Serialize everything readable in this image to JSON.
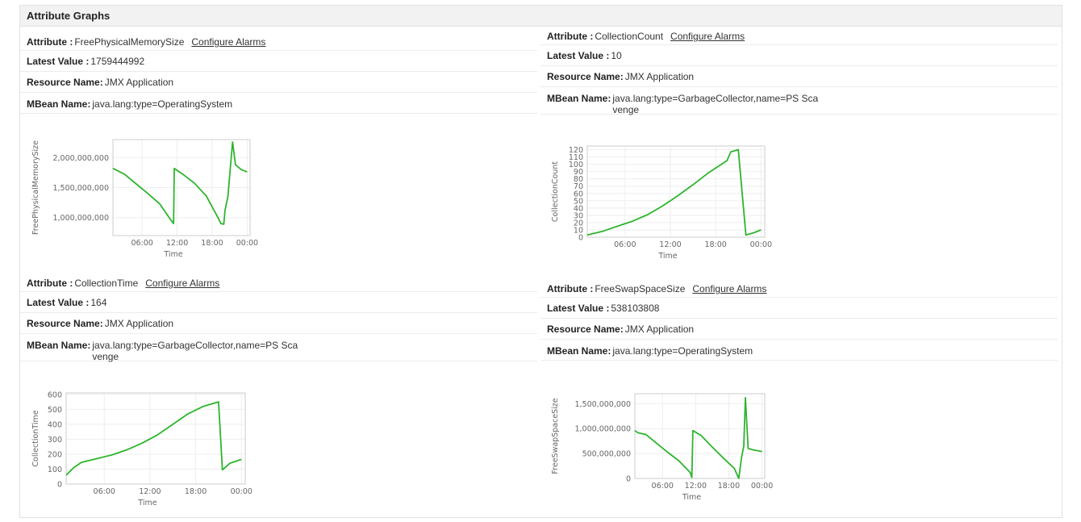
{
  "panel": {
    "title": "Attribute Graphs"
  },
  "labels": {
    "attribute": "Attribute :",
    "latest_value": "Latest Value :",
    "resource_name": "Resource Name:",
    "mbean_name": "MBean Name:",
    "configure_alarms": "Configure Alarms"
  },
  "cards": [
    {
      "attribute": "FreePhysicalMemorySize",
      "latest_value": "1759444992",
      "resource_name": "JMX Application",
      "mbean_name": "java.lang:type=OperatingSystem"
    },
    {
      "attribute": "CollectionCount",
      "latest_value": "10",
      "resource_name": "JMX Application",
      "mbean_name": "java.lang:type=GarbageCollector,name=PS Scavenge"
    },
    {
      "attribute": "CollectionTime",
      "latest_value": "164",
      "resource_name": "JMX Application",
      "mbean_name": "java.lang:type=GarbageCollector,name=PS Scavenge"
    },
    {
      "attribute": "FreeSwapSpaceSize",
      "latest_value": "538103808",
      "resource_name": "JMX Application",
      "mbean_name": "java.lang:type=OperatingSystem"
    }
  ],
  "line_color": "#2db52d",
  "chart_data": [
    {
      "type": "line",
      "ylabel": "FreePhysicalMemorySize",
      "xlabel": "Time",
      "x_ticks": [
        "06:00",
        "12:00",
        "18:00",
        "00:00"
      ],
      "x_tick_hours": [
        6,
        12,
        18,
        24
      ],
      "xlim": [
        1,
        24.5
      ],
      "y_ticks": [
        "1,000,000,000",
        "1,500,000,000",
        "2,000,000,000"
      ],
      "y_tick_values": [
        1000000000,
        1500000000,
        2000000000
      ],
      "ylim": [
        700000000,
        2300000000
      ],
      "x": [
        1.0,
        3.0,
        5.0,
        7.0,
        9.0,
        11.0,
        11.4,
        11.5,
        13.0,
        15.0,
        17.0,
        19.0,
        19.5,
        20.0,
        20.2,
        20.7,
        21.0,
        21.5,
        22.0,
        23.0,
        24.0
      ],
      "y": [
        1820000000,
        1720000000,
        1560000000,
        1400000000,
        1230000000,
        950000000,
        900000000,
        1820000000,
        1720000000,
        1570000000,
        1360000000,
        1000000000,
        900000000,
        890000000,
        1120000000,
        1350000000,
        1700000000,
        2260000000,
        1880000000,
        1800000000,
        1760000000
      ]
    },
    {
      "type": "line",
      "ylabel": "CollectionCount",
      "xlabel": "Time",
      "x_ticks": [
        "06:00",
        "12:00",
        "18:00",
        "00:00"
      ],
      "x_tick_hours": [
        6,
        12,
        18,
        24
      ],
      "xlim": [
        1,
        24.5
      ],
      "y_ticks": [
        "0",
        "10",
        "20",
        "30",
        "40",
        "50",
        "60",
        "70",
        "80",
        "90",
        "100",
        "110",
        "120"
      ],
      "y_tick_values": [
        0,
        10,
        20,
        30,
        40,
        50,
        60,
        70,
        80,
        90,
        100,
        110,
        120
      ],
      "ylim": [
        0,
        125
      ],
      "x": [
        1.0,
        3.0,
        5.0,
        7.0,
        9.0,
        11.0,
        13.0,
        15.0,
        17.0,
        19.5,
        20.0,
        21.0,
        22.0,
        23.0,
        24.0
      ],
      "y": [
        3,
        8,
        15,
        22,
        31,
        43,
        57,
        72,
        88,
        105,
        117,
        120,
        3,
        6,
        10
      ]
    },
    {
      "type": "line",
      "ylabel": "CollectionTime",
      "xlabel": "Time",
      "x_ticks": [
        "06:00",
        "12:00",
        "18:00",
        "00:00"
      ],
      "x_tick_hours": [
        6,
        12,
        18,
        24
      ],
      "xlim": [
        1,
        24.5
      ],
      "y_ticks": [
        "0",
        "100",
        "200",
        "300",
        "400",
        "500",
        "600"
      ],
      "y_tick_values": [
        0,
        100,
        200,
        300,
        400,
        500,
        600
      ],
      "ylim": [
        0,
        610
      ],
      "x": [
        1.0,
        2.0,
        3.0,
        5.0,
        7.0,
        9.0,
        11.0,
        13.0,
        15.0,
        17.0,
        19.0,
        21.0,
        21.5,
        22.5,
        24.0
      ],
      "y": [
        60,
        110,
        145,
        170,
        195,
        230,
        275,
        330,
        400,
        470,
        520,
        550,
        95,
        140,
        165
      ]
    },
    {
      "type": "line",
      "ylabel": "FreeSwapSpaceSize",
      "xlabel": "Time",
      "x_ticks": [
        "06:00",
        "12:00",
        "18:00",
        "00:00"
      ],
      "x_tick_hours": [
        6,
        12,
        18,
        24
      ],
      "xlim": [
        1,
        24.5
      ],
      "y_ticks": [
        "0",
        "500,000,000",
        "1,000,000,000",
        "1,500,000,000"
      ],
      "y_tick_values": [
        0,
        500000000,
        1000000000,
        1500000000
      ],
      "ylim": [
        0,
        1700000000
      ],
      "x": [
        1.0,
        1.5,
        3.0,
        5.0,
        7.0,
        9.0,
        11.0,
        11.3,
        11.5,
        13.0,
        15.0,
        17.0,
        19.0,
        19.8,
        20.3,
        20.7,
        21.0,
        21.5,
        22.5,
        24.0
      ],
      "y": [
        960000000,
        920000000,
        880000000,
        700000000,
        520000000,
        350000000,
        120000000,
        20000000,
        960000000,
        860000000,
        630000000,
        410000000,
        200000000,
        0,
        420000000,
        650000000,
        1620000000,
        600000000,
        570000000,
        540000000
      ]
    }
  ]
}
